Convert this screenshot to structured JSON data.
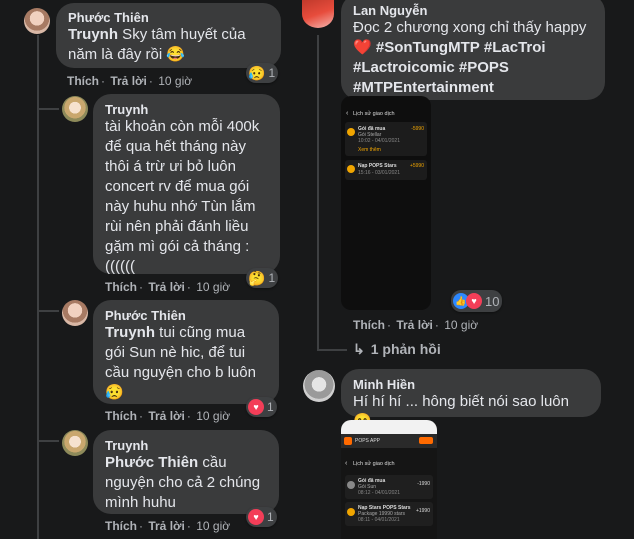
{
  "left_thread": {
    "comments": [
      {
        "author": "Phước Thiên",
        "mention": "Truynh",
        "text": " Sky tâm huyết của năm là đây rồi 😂",
        "like": "Thích",
        "reply": "Trả lời",
        "time": "10 giờ",
        "reaction_count": "1"
      },
      {
        "author": "Truynh",
        "text": "tài khoản còn mỗi 400k để qua hết tháng này thôi á trừ ưi bỏ luôn concert rv để mua gói này huhu nhớ Tùn lắm rùi nên phải đánh liều gặm mì gói cả tháng : ((((((",
        "like": "Thích",
        "reply": "Trả lời",
        "time": "10 giờ",
        "reaction_count": "1"
      },
      {
        "author": "Phước Thiên",
        "mention": "Truynh",
        "text": " tui cũng mua gói Sun nè hic, để tui cầu nguyện cho b luôn 😥",
        "like": "Thích",
        "reply": "Trả lời",
        "time": "10 giờ",
        "reaction_count": "1"
      },
      {
        "author": "Truynh",
        "mention": "Phước Thiên",
        "text": " cầu nguyện cho cả 2 chúng mình huhu",
        "like": "Thích",
        "reply": "Trả lời",
        "time": "10 giờ",
        "reaction_count": "1"
      }
    ]
  },
  "right_thread": {
    "comment1": {
      "author": "Lan Nguyễn",
      "text_prefix": "Đọc 2 chương xong chỉ thấy happy ❤️ ",
      "hashtags": [
        "#SonTungMTP",
        "#LacTroi",
        "#Lactroicomic",
        "#POPS",
        "#MTPEntertainment"
      ],
      "like": "Thích",
      "reply": "Trả lời",
      "time": "10 giờ",
      "reaction_count": "10",
      "replies_link": "1 phản hồi",
      "screenshot": {
        "title": "Lịch sử giao dịch",
        "row1_title": "Gói đã mua",
        "row1_sub": "Gói Stellar",
        "row1_date": "10:02 - 04/01/2021",
        "row1_amount": "-5990",
        "row1_tag": "Xem thêm",
        "row2_title": "Nạp POPS Stars",
        "row2_date": "15:16 - 03/01/2021",
        "row2_amount": "+5990"
      }
    },
    "comment2": {
      "author": "Minh Hiền",
      "text": "Hí hí hí ... hông biết nói sao luôn 😄",
      "screenshot": {
        "app_name": "POPS APP",
        "title": "Lịch sử giao dịch",
        "row1_title": "Gói đã mua",
        "row1_sub": "Gói Sun",
        "row1_date": "08:12 - 04/01/2021",
        "row1_amount": "-1990",
        "row2_title": "Nạp Stars POPS Stars",
        "row2_sub": "Package 19990 stars",
        "row2_date": "08:11 - 04/01/2021",
        "row2_amount": "+1990"
      }
    }
  }
}
